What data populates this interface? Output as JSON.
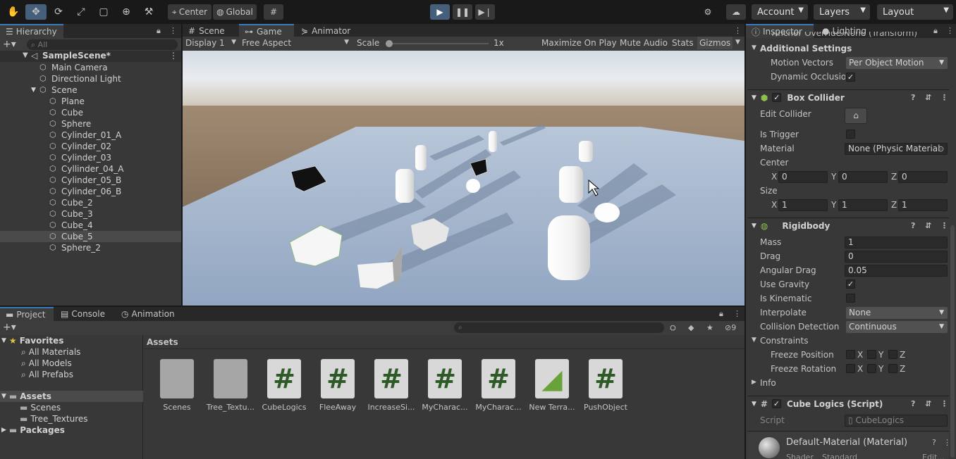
{
  "toolbar": {
    "pivot_label": "Center",
    "space_label": "Global",
    "account_label": "Account",
    "layers_label": "Layers",
    "layout_label": "Layout"
  },
  "hierarchy": {
    "tab": "Hierarchy",
    "search_placeholder": "All",
    "scene_name": "SampleScene*",
    "items": [
      {
        "label": "Main Camera",
        "depth": 1
      },
      {
        "label": "Directional Light",
        "depth": 1
      },
      {
        "label": "Scene",
        "depth": 1
      },
      {
        "label": "Plane",
        "depth": 2
      },
      {
        "label": "Cube",
        "depth": 2
      },
      {
        "label": "Sphere",
        "depth": 2
      },
      {
        "label": "Cylinder_01_A",
        "depth": 2
      },
      {
        "label": "Cylinder_02",
        "depth": 2
      },
      {
        "label": "Cylinder_03",
        "depth": 2
      },
      {
        "label": "Cyllinder_04_A",
        "depth": 2
      },
      {
        "label": "Cylinder_05_B",
        "depth": 2
      },
      {
        "label": "Cylinder_06_B",
        "depth": 2
      },
      {
        "label": "Cube_2",
        "depth": 2
      },
      {
        "label": "Cube_3",
        "depth": 2
      },
      {
        "label": "Cube_4",
        "depth": 2
      },
      {
        "label": "Cube_5",
        "depth": 2
      },
      {
        "label": "Sphere_2",
        "depth": 2
      }
    ]
  },
  "game": {
    "tabs": [
      "Scene",
      "Game",
      "Animator"
    ],
    "display": "Display 1",
    "aspect": "Free Aspect",
    "scale_label": "Scale",
    "scale_value": "1x",
    "maximize": "Maximize On Play",
    "mute": "Mute Audio",
    "stats": "Stats",
    "gizmos": "Gizmos"
  },
  "project": {
    "tabs": [
      "Project",
      "Console",
      "Animation"
    ],
    "favorites": "Favorites",
    "favorite_items": [
      "All Materials",
      "All Models",
      "All Prefabs"
    ],
    "assets_root": "Assets",
    "asset_folders": [
      "Scenes",
      "Tree_Textures"
    ],
    "packages": "Packages",
    "breadcrumb": "Assets",
    "hidden_count": "9",
    "assets": [
      {
        "label": "Scenes",
        "kind": "folder"
      },
      {
        "label": "Tree_Textu...",
        "kind": "folder"
      },
      {
        "label": "CubeLogics",
        "kind": "script"
      },
      {
        "label": "FleeAway",
        "kind": "script"
      },
      {
        "label": "IncreaseSi...",
        "kind": "script"
      },
      {
        "label": "MyCharac...",
        "kind": "script"
      },
      {
        "label": "MyCharac...",
        "kind": "script"
      },
      {
        "label": "New Terra...",
        "kind": "terrain"
      },
      {
        "label": "PushObject",
        "kind": "script"
      }
    ]
  },
  "inspector": {
    "tabs": [
      "Inspector",
      "Lighting"
    ],
    "anchor_override": "Anchor Override   None (Transform)",
    "additional_settings": "Additional Settings",
    "motion_vectors_label": "Motion Vectors",
    "motion_vectors_value": "Per Object Motion",
    "dynamic_occlusion_label": "Dynamic Occlusio",
    "box_collider": {
      "title": "Box Collider",
      "edit_collider": "Edit Collider",
      "is_trigger": "Is Trigger",
      "material_label": "Material",
      "material_value": "None (Physic Material",
      "center_label": "Center",
      "center": {
        "x": "0",
        "y": "0",
        "z": "0"
      },
      "size_label": "Size",
      "size": {
        "x": "1",
        "y": "1",
        "z": "1"
      }
    },
    "rigidbody": {
      "title": "Rigidbody",
      "mass_label": "Mass",
      "mass": "1",
      "drag_label": "Drag",
      "drag": "0",
      "angular_drag_label": "Angular Drag",
      "angular_drag": "0.05",
      "use_gravity": "Use Gravity",
      "is_kinematic": "Is Kinematic",
      "interpolate_label": "Interpolate",
      "interpolate": "None",
      "collision_label": "Collision Detection",
      "collision": "Continuous",
      "constraints": "Constraints",
      "freeze_position": "Freeze Position",
      "freeze_rotation": "Freeze Rotation",
      "info": "Info"
    },
    "script": {
      "title": "Cube Logics (Script)",
      "script_label": "Script",
      "script_value": "CubeLogics"
    },
    "material": {
      "title": "Default-Material (Material)",
      "shader_label": "Shader",
      "shader_value": "Standard",
      "edit": "Edit..."
    },
    "axis_x": "X",
    "axis_y": "Y",
    "axis_z": "Z"
  }
}
